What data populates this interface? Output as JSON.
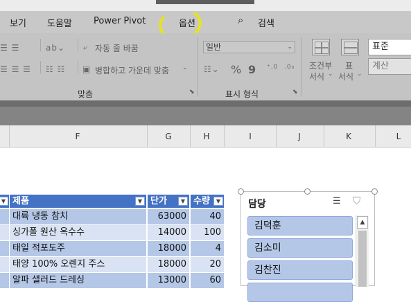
{
  "menu": {
    "items": [
      "보기",
      "도움말",
      "Power Pivot",
      "옵션"
    ],
    "search_label": "검색"
  },
  "ribbon": {
    "wrap_text": "자동 줄 바꿈",
    "merge_center": "병합하고 가운데 맞춤",
    "number_format": "일반",
    "percent": "%",
    "comma": "9",
    "conditional_format": [
      "조건부",
      "서식"
    ],
    "format_as_table": [
      "표",
      "서식"
    ],
    "style_normal": "표준",
    "style_calc": "계산",
    "group_alignment": "맞춤",
    "group_number": "표시 형식"
  },
  "columns": [
    "F",
    "G",
    "H",
    "I",
    "J",
    "K",
    "L"
  ],
  "table": {
    "headers": [
      "제품",
      "단가",
      "수량"
    ],
    "rows": [
      [
        "대륙 냉동 참치",
        "63000",
        "40"
      ],
      [
        "싱가폴 원산 옥수수",
        "14000",
        "100"
      ],
      [
        "태일 적포도주",
        "18000",
        "4"
      ],
      [
        "태양 100% 오렌지 주스",
        "18000",
        "20"
      ],
      [
        "알파 샐러드 드레싱",
        "13000",
        "60"
      ]
    ]
  },
  "slicer": {
    "title": "담당",
    "items": [
      "김덕훈",
      "김소미",
      "김찬진",
      ""
    ]
  },
  "colors": {
    "table_header": "#4472c4",
    "row_light": "#dae3f3",
    "row_dark": "#b4c7e7",
    "highlight": "#e5e51b"
  },
  "icons": [
    "search-icon",
    "multi-select-icon",
    "clear-filter-icon",
    "filter-dropdown-icon",
    "scroll-up-icon"
  ]
}
